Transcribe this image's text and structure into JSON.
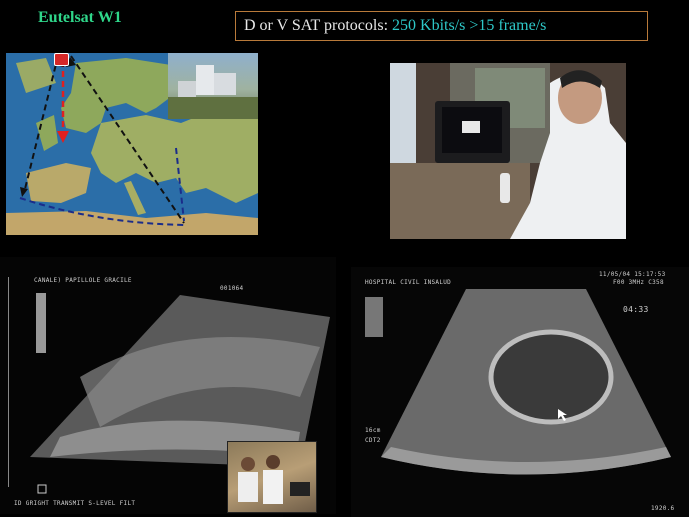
{
  "satellite_title": "Eutelsat W1",
  "protocol": {
    "label": "D or V SAT protocols:",
    "bandwidth": "250 Kbits/s",
    "framerate": ">15 frame/s"
  },
  "colors": {
    "title_green": "#2fd68a",
    "value_cyan": "#2ec8c8",
    "box_border": "#b97a3a",
    "uplink_red": "#e02020"
  },
  "us_left": {
    "header": "CANALE) PAPILLOLE GRACILE",
    "id": "001064",
    "footer": "ID  GRIGHT  TRANSMIT  S-LEVEL  FILT"
  },
  "us_right": {
    "hospital": "HOSPITAL CIVIL INSALUD",
    "date": "11/05/04 15:17:53",
    "freq": "F00   3MHz  C358",
    "timer": "04:33",
    "depth": "16cm",
    "gain": "CDT2",
    "corner": "1920.6"
  }
}
